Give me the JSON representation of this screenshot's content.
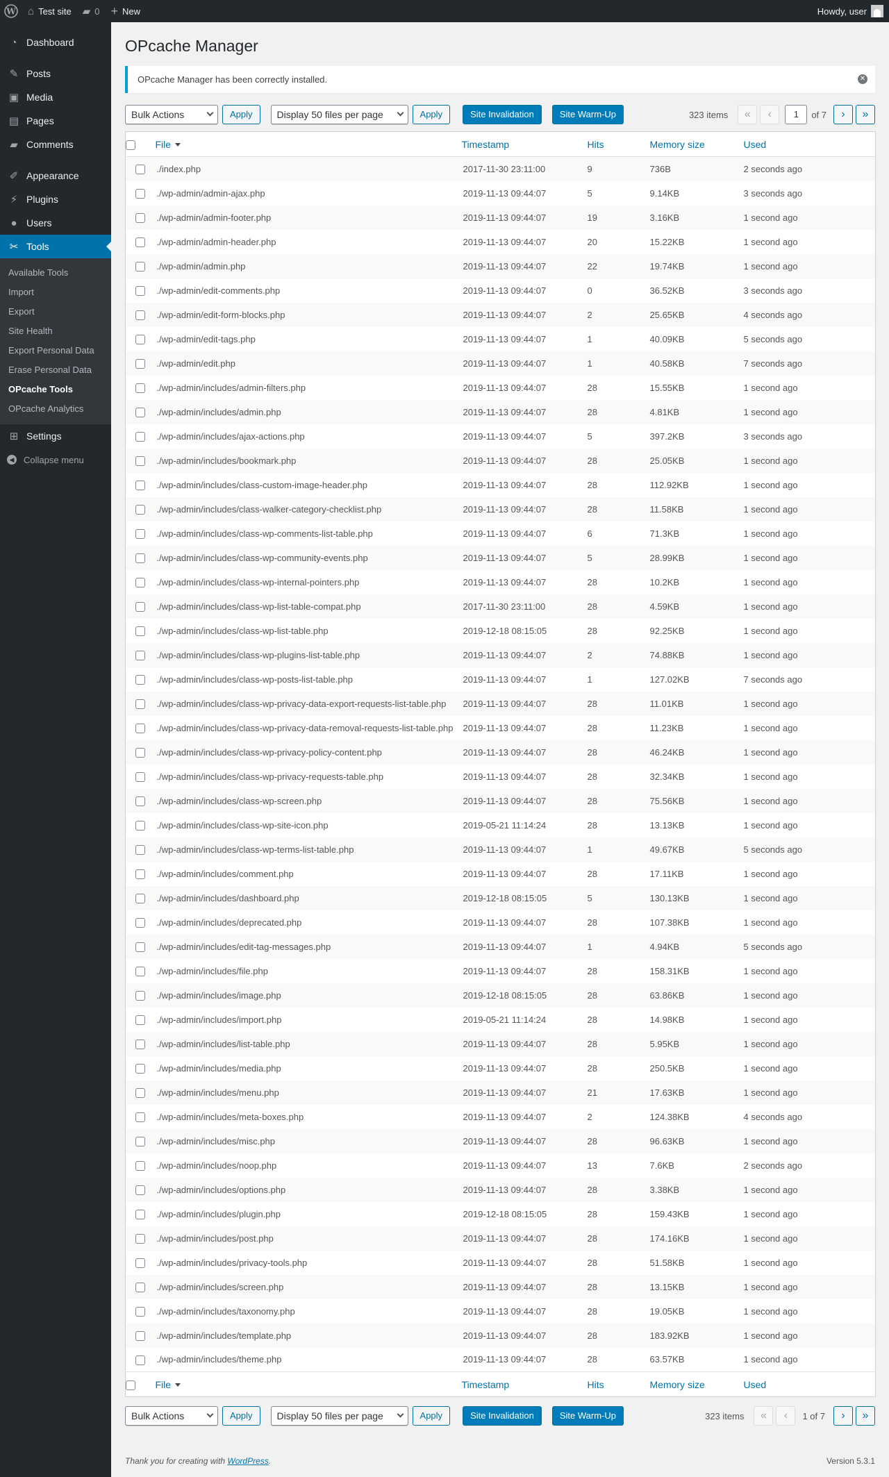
{
  "adminbar": {
    "site_name": "Test site",
    "comments_count": "0",
    "new_label": "New",
    "howdy": "Howdy, user"
  },
  "sidebar": {
    "items": [
      {
        "label": "Dashboard",
        "icon": "dashboard-icon"
      },
      {
        "label": "Posts",
        "icon": "pin-icon"
      },
      {
        "label": "Media",
        "icon": "media-icon"
      },
      {
        "label": "Pages",
        "icon": "page-icon"
      },
      {
        "label": "Comments",
        "icon": "comment-icon"
      },
      {
        "label": "Appearance",
        "icon": "brush-icon"
      },
      {
        "label": "Plugins",
        "icon": "plug-icon"
      },
      {
        "label": "Users",
        "icon": "user-icon"
      },
      {
        "label": "Tools",
        "icon": "wrench-icon"
      },
      {
        "label": "Settings",
        "icon": "settings-icon"
      }
    ],
    "tools_submenu": [
      "Available Tools",
      "Import",
      "Export",
      "Site Health",
      "Export Personal Data",
      "Erase Personal Data",
      "OPcache Tools",
      "OPcache Analytics"
    ],
    "collapse_label": "Collapse menu"
  },
  "page": {
    "title": "OPcache Manager",
    "notice": "OPcache Manager has been correctly installed."
  },
  "tablenav": {
    "bulk_actions": "Bulk Actions",
    "apply": "Apply",
    "per_page": "Display 50 files per page",
    "site_invalidation": "Site Invalidation",
    "site_warmup": "Site Warm-Up",
    "items_count": "323 items",
    "first": "«",
    "prev": "‹",
    "next": "›",
    "last": "»",
    "current_page": "1",
    "of_pages": "of 7",
    "bottom_pages": "1 of 7"
  },
  "table": {
    "columns": [
      "File",
      "Timestamp",
      "Hits",
      "Memory size",
      "Used"
    ],
    "rows": [
      [
        "./index.php",
        "2017-11-30 23:11:00",
        "9",
        "736B",
        "2 seconds ago"
      ],
      [
        "./wp-admin/admin-ajax.php",
        "2019-11-13 09:44:07",
        "5",
        "9.14KB",
        "3 seconds ago"
      ],
      [
        "./wp-admin/admin-footer.php",
        "2019-11-13 09:44:07",
        "19",
        "3.16KB",
        "1 second ago"
      ],
      [
        "./wp-admin/admin-header.php",
        "2019-11-13 09:44:07",
        "20",
        "15.22KB",
        "1 second ago"
      ],
      [
        "./wp-admin/admin.php",
        "2019-11-13 09:44:07",
        "22",
        "19.74KB",
        "1 second ago"
      ],
      [
        "./wp-admin/edit-comments.php",
        "2019-11-13 09:44:07",
        "0",
        "36.52KB",
        "3 seconds ago"
      ],
      [
        "./wp-admin/edit-form-blocks.php",
        "2019-11-13 09:44:07",
        "2",
        "25.65KB",
        "4 seconds ago"
      ],
      [
        "./wp-admin/edit-tags.php",
        "2019-11-13 09:44:07",
        "1",
        "40.09KB",
        "5 seconds ago"
      ],
      [
        "./wp-admin/edit.php",
        "2019-11-13 09:44:07",
        "1",
        "40.58KB",
        "7 seconds ago"
      ],
      [
        "./wp-admin/includes/admin-filters.php",
        "2019-11-13 09:44:07",
        "28",
        "15.55KB",
        "1 second ago"
      ],
      [
        "./wp-admin/includes/admin.php",
        "2019-11-13 09:44:07",
        "28",
        "4.81KB",
        "1 second ago"
      ],
      [
        "./wp-admin/includes/ajax-actions.php",
        "2019-11-13 09:44:07",
        "5",
        "397.2KB",
        "3 seconds ago"
      ],
      [
        "./wp-admin/includes/bookmark.php",
        "2019-11-13 09:44:07",
        "28",
        "25.05KB",
        "1 second ago"
      ],
      [
        "./wp-admin/includes/class-custom-image-header.php",
        "2019-11-13 09:44:07",
        "28",
        "112.92KB",
        "1 second ago"
      ],
      [
        "./wp-admin/includes/class-walker-category-checklist.php",
        "2019-11-13 09:44:07",
        "28",
        "11.58KB",
        "1 second ago"
      ],
      [
        "./wp-admin/includes/class-wp-comments-list-table.php",
        "2019-11-13 09:44:07",
        "6",
        "71.3KB",
        "1 second ago"
      ],
      [
        "./wp-admin/includes/class-wp-community-events.php",
        "2019-11-13 09:44:07",
        "5",
        "28.99KB",
        "1 second ago"
      ],
      [
        "./wp-admin/includes/class-wp-internal-pointers.php",
        "2019-11-13 09:44:07",
        "28",
        "10.2KB",
        "1 second ago"
      ],
      [
        "./wp-admin/includes/class-wp-list-table-compat.php",
        "2017-11-30 23:11:00",
        "28",
        "4.59KB",
        "1 second ago"
      ],
      [
        "./wp-admin/includes/class-wp-list-table.php",
        "2019-12-18 08:15:05",
        "28",
        "92.25KB",
        "1 second ago"
      ],
      [
        "./wp-admin/includes/class-wp-plugins-list-table.php",
        "2019-11-13 09:44:07",
        "2",
        "74.88KB",
        "1 second ago"
      ],
      [
        "./wp-admin/includes/class-wp-posts-list-table.php",
        "2019-11-13 09:44:07",
        "1",
        "127.02KB",
        "7 seconds ago"
      ],
      [
        "./wp-admin/includes/class-wp-privacy-data-export-requests-list-table.php",
        "2019-11-13 09:44:07",
        "28",
        "11.01KB",
        "1 second ago"
      ],
      [
        "./wp-admin/includes/class-wp-privacy-data-removal-requests-list-table.php",
        "2019-11-13 09:44:07",
        "28",
        "11.23KB",
        "1 second ago"
      ],
      [
        "./wp-admin/includes/class-wp-privacy-policy-content.php",
        "2019-11-13 09:44:07",
        "28",
        "46.24KB",
        "1 second ago"
      ],
      [
        "./wp-admin/includes/class-wp-privacy-requests-table.php",
        "2019-11-13 09:44:07",
        "28",
        "32.34KB",
        "1 second ago"
      ],
      [
        "./wp-admin/includes/class-wp-screen.php",
        "2019-11-13 09:44:07",
        "28",
        "75.56KB",
        "1 second ago"
      ],
      [
        "./wp-admin/includes/class-wp-site-icon.php",
        "2019-05-21 11:14:24",
        "28",
        "13.13KB",
        "1 second ago"
      ],
      [
        "./wp-admin/includes/class-wp-terms-list-table.php",
        "2019-11-13 09:44:07",
        "1",
        "49.67KB",
        "5 seconds ago"
      ],
      [
        "./wp-admin/includes/comment.php",
        "2019-11-13 09:44:07",
        "28",
        "17.11KB",
        "1 second ago"
      ],
      [
        "./wp-admin/includes/dashboard.php",
        "2019-12-18 08:15:05",
        "5",
        "130.13KB",
        "1 second ago"
      ],
      [
        "./wp-admin/includes/deprecated.php",
        "2019-11-13 09:44:07",
        "28",
        "107.38KB",
        "1 second ago"
      ],
      [
        "./wp-admin/includes/edit-tag-messages.php",
        "2019-11-13 09:44:07",
        "1",
        "4.94KB",
        "5 seconds ago"
      ],
      [
        "./wp-admin/includes/file.php",
        "2019-11-13 09:44:07",
        "28",
        "158.31KB",
        "1 second ago"
      ],
      [
        "./wp-admin/includes/image.php",
        "2019-12-18 08:15:05",
        "28",
        "63.86KB",
        "1 second ago"
      ],
      [
        "./wp-admin/includes/import.php",
        "2019-05-21 11:14:24",
        "28",
        "14.98KB",
        "1 second ago"
      ],
      [
        "./wp-admin/includes/list-table.php",
        "2019-11-13 09:44:07",
        "28",
        "5.95KB",
        "1 second ago"
      ],
      [
        "./wp-admin/includes/media.php",
        "2019-11-13 09:44:07",
        "28",
        "250.5KB",
        "1 second ago"
      ],
      [
        "./wp-admin/includes/menu.php",
        "2019-11-13 09:44:07",
        "21",
        "17.63KB",
        "1 second ago"
      ],
      [
        "./wp-admin/includes/meta-boxes.php",
        "2019-11-13 09:44:07",
        "2",
        "124.38KB",
        "4 seconds ago"
      ],
      [
        "./wp-admin/includes/misc.php",
        "2019-11-13 09:44:07",
        "28",
        "96.63KB",
        "1 second ago"
      ],
      [
        "./wp-admin/includes/noop.php",
        "2019-11-13 09:44:07",
        "13",
        "7.6KB",
        "2 seconds ago"
      ],
      [
        "./wp-admin/includes/options.php",
        "2019-11-13 09:44:07",
        "28",
        "3.38KB",
        "1 second ago"
      ],
      [
        "./wp-admin/includes/plugin.php",
        "2019-12-18 08:15:05",
        "28",
        "159.43KB",
        "1 second ago"
      ],
      [
        "./wp-admin/includes/post.php",
        "2019-11-13 09:44:07",
        "28",
        "174.16KB",
        "1 second ago"
      ],
      [
        "./wp-admin/includes/privacy-tools.php",
        "2019-11-13 09:44:07",
        "28",
        "51.58KB",
        "1 second ago"
      ],
      [
        "./wp-admin/includes/screen.php",
        "2019-11-13 09:44:07",
        "28",
        "13.15KB",
        "1 second ago"
      ],
      [
        "./wp-admin/includes/taxonomy.php",
        "2019-11-13 09:44:07",
        "28",
        "19.05KB",
        "1 second ago"
      ],
      [
        "./wp-admin/includes/template.php",
        "2019-11-13 09:44:07",
        "28",
        "183.92KB",
        "1 second ago"
      ],
      [
        "./wp-admin/includes/theme.php",
        "2019-11-13 09:44:07",
        "28",
        "63.57KB",
        "1 second ago"
      ]
    ]
  },
  "footer": {
    "thanks": "Thank you for creating with ",
    "link": "WordPress",
    "period": ".",
    "version": "Version 5.3.1"
  },
  "colors": {
    "accent": "#0073aa",
    "adminbar": "#23282d",
    "notice_border": "#00a0d2"
  }
}
